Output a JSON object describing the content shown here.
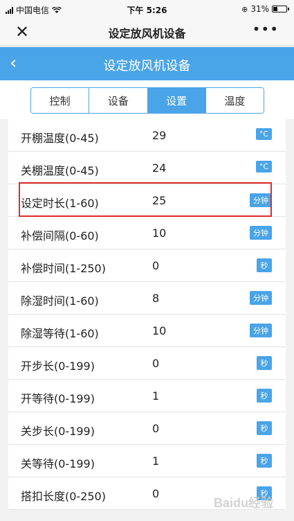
{
  "statusbar": {
    "carrier": "中国电信",
    "time": "下午 5:26",
    "battery": "31%",
    "battery_level": 0.31
  },
  "navbar": {
    "close_icon": "close-icon",
    "title": "设定放风机设备",
    "more_icon": "more-icon",
    "more": "•••"
  },
  "header": {
    "back": "‹",
    "title": "设定放风机设备"
  },
  "tabs": [
    {
      "label": "控制",
      "active": false
    },
    {
      "label": "设备",
      "active": false
    },
    {
      "label": "设置",
      "active": true
    },
    {
      "label": "温度",
      "active": false
    }
  ],
  "rows": [
    {
      "label": "开棚温度(0-45)",
      "value": "29",
      "unit": "°C"
    },
    {
      "label": "关棚温度(0-45)",
      "value": "24",
      "unit": "°C"
    },
    {
      "label": "设定时长(1-60)",
      "value": "25",
      "unit": "分钟"
    },
    {
      "label": "补偿间隔(0-60)",
      "value": "10",
      "unit": "分钟"
    },
    {
      "label": "补偿时间(1-250)",
      "value": "0",
      "unit": "秒"
    },
    {
      "label": "除湿时间(1-60)",
      "value": "8",
      "unit": "分钟"
    },
    {
      "label": "除湿等待(1-60)",
      "value": "10",
      "unit": "分钟"
    },
    {
      "label": "开步长(0-199)",
      "value": "0",
      "unit": "秒"
    },
    {
      "label": "开等待(0-199)",
      "value": "1",
      "unit": "秒"
    },
    {
      "label": "关步长(0-199)",
      "value": "0",
      "unit": "秒"
    },
    {
      "label": "关等待(0-199)",
      "value": "1",
      "unit": "秒"
    },
    {
      "label": "搭扣长度(0-250)",
      "value": "0",
      "unit": "秒"
    }
  ],
  "colors": {
    "accent": "#4aa4e8",
    "highlight": "#e02a2a"
  },
  "watermark": "Baidu经验"
}
